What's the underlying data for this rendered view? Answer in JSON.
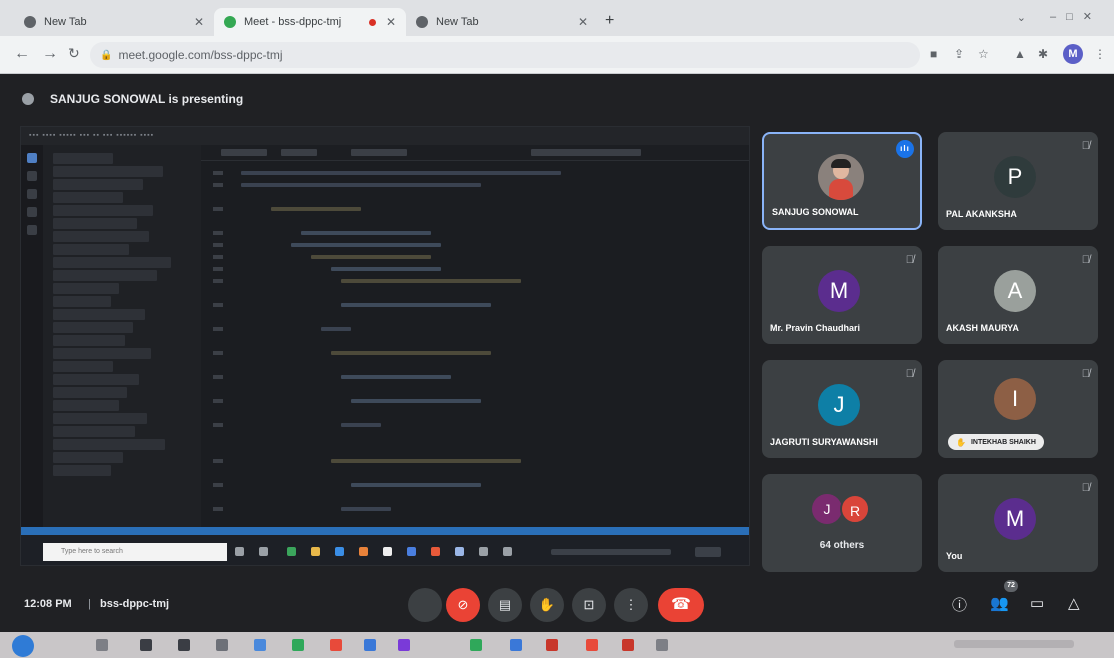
{
  "browser": {
    "tabs": [
      {
        "title": "New Tab",
        "active": false
      },
      {
        "title": "Meet - bss-dppc-tmj",
        "active": true
      },
      {
        "title": "New Tab",
        "active": false
      }
    ],
    "new_tab_symbol": "+",
    "url": "meet.google.com/bss-dppc-tmj",
    "profile_initial": "M"
  },
  "meet": {
    "presenting_text": "SANJUG SONOWAL is presenting",
    "participants": [
      {
        "name": "SANJUG SONOWAL",
        "type": "photo",
        "speaking": true
      },
      {
        "name": "PAL AKANKSHA",
        "initial": "P",
        "color": "#2f3b3c"
      },
      {
        "name": "Mr. Pravin Chaudhari",
        "initial": "M",
        "color": "#5b2d8e"
      },
      {
        "name": "AKASH MAURYA",
        "initial": "A",
        "color": "#9aa09c"
      },
      {
        "name": "JAGRUTI SURYAWANSHI",
        "initial": "J",
        "color": "#0e7fa6"
      },
      {
        "name": "INTEKHAB SHAIKH",
        "initial": "I",
        "color": "#8d5f45",
        "hand_raised": true
      },
      {
        "name": "64 others",
        "initials": [
          "J",
          "R"
        ],
        "colors": [
          "#7a2b6f",
          "#d9453a"
        ]
      },
      {
        "name": "You",
        "initial": "M",
        "color": "#5b2d8e"
      }
    ],
    "bottom_bar": {
      "time": "12:08 PM",
      "meeting_code": "bss-dppc-tmj",
      "participant_count": "72"
    },
    "shared_screen": {
      "taskbar_search_placeholder": "Type here to search"
    }
  }
}
